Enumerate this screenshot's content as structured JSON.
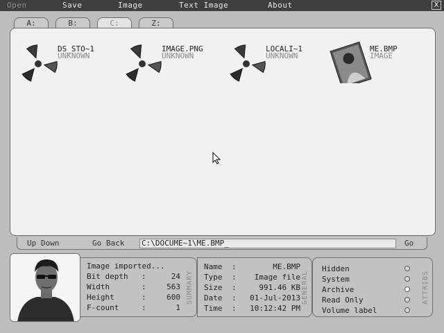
{
  "menubar": {
    "items": [
      "Open",
      "Save",
      "Image",
      "Text Image",
      "About"
    ],
    "close_label": "X"
  },
  "drives": [
    "A:",
    "B:",
    "C:",
    "Z:"
  ],
  "files": [
    {
      "name": "DS_STO~1",
      "type": "UNKNOWN",
      "icon": "radiation-icon"
    },
    {
      "name": "IMAGE.PNG",
      "type": "UNKNOWN",
      "icon": "radiation-icon"
    },
    {
      "name": "LOCALI~1",
      "type": "UNKNOWN",
      "icon": "radiation-icon"
    },
    {
      "name": "ME.BMP",
      "type": "IMAGE",
      "icon": "image-thumbnail"
    }
  ],
  "nav": {
    "up_down": "Up Down",
    "go_back": "Go Back",
    "path": "C:\\DOCUME~1\\ME.BMP_",
    "go": "Go"
  },
  "summary": {
    "label": "SUMMARY",
    "status": "Image imported...",
    "rows": [
      {
        "key": "Bit depth",
        "value": "24"
      },
      {
        "key": "Width",
        "value": "563"
      },
      {
        "key": "Height",
        "value": "600"
      },
      {
        "key": "F-count",
        "value": "1"
      }
    ]
  },
  "general": {
    "label": "GENERAL",
    "rows": [
      {
        "key": "Name",
        "value": "ME.BMP"
      },
      {
        "key": "Type",
        "value": "Image file"
      },
      {
        "key": "Size",
        "value": "991.46 KB"
      },
      {
        "key": "Date",
        "value": "01-Jul-2013"
      },
      {
        "key": "Time",
        "value": "10:12:42 PM"
      }
    ]
  },
  "attribs": {
    "label": "ATTRIBS",
    "items": [
      {
        "label": "Hidden",
        "checked": false
      },
      {
        "label": "System",
        "checked": false
      },
      {
        "label": "Archive",
        "checked": true
      },
      {
        "label": "Read Only",
        "checked": false
      },
      {
        "label": "Volume label",
        "checked": false
      }
    ]
  },
  "colors": {
    "menubar": "#3f3f3f",
    "panel": "#f1f1f1",
    "background": "#bdbdbd"
  }
}
